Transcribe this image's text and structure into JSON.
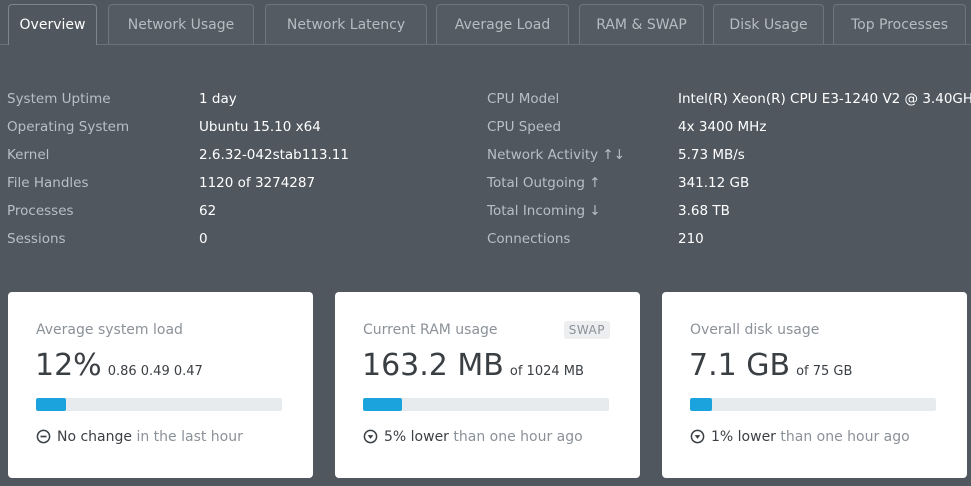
{
  "tabs": [
    {
      "label": "Overview"
    },
    {
      "label": "Network Usage"
    },
    {
      "label": "Network Latency"
    },
    {
      "label": "Average Load"
    },
    {
      "label": "RAM & SWAP"
    },
    {
      "label": "Disk Usage"
    },
    {
      "label": "Top Processes"
    }
  ],
  "info_left": [
    {
      "label": "System Uptime",
      "value": "1 day"
    },
    {
      "label": "Operating System",
      "value": "Ubuntu 15.10 x64"
    },
    {
      "label": "Kernel",
      "value": "2.6.32-042stab113.11"
    },
    {
      "label": "File Handles",
      "value": "1120 of 3274287"
    },
    {
      "label": "Processes",
      "value": "62"
    },
    {
      "label": "Sessions",
      "value": "0"
    }
  ],
  "info_right": [
    {
      "label": "CPU Model",
      "value": "Intel(R) Xeon(R) CPU E3-1240 V2 @ 3.40GH..."
    },
    {
      "label": "CPU Speed",
      "value": "4x 3400 MHz"
    },
    {
      "label": "Network Activity ↑↓",
      "value": "5.73 MB/s"
    },
    {
      "label": "Total Outgoing ↑",
      "value": "341.12 GB"
    },
    {
      "label": "Total Incoming ↓",
      "value": "3.68 TB"
    },
    {
      "label": "Connections",
      "value": "210"
    }
  ],
  "cards": {
    "load": {
      "title": "Average system load",
      "big": "12%",
      "sub": "0.86 0.49 0.47",
      "progress_fraction": 0.12,
      "trend_main": "No change",
      "trend_muted": " in the last hour",
      "trend_icon": "minus-circle-icon"
    },
    "ram": {
      "title": "Current RAM usage",
      "badge": "SWAP",
      "big": "163.2 MB",
      "sub": "of 1024 MB",
      "progress_fraction": 0.16,
      "trend_main": "5% lower",
      "trend_muted": " than one hour ago",
      "trend_icon": "arrow-down-circle-icon"
    },
    "disk": {
      "title": "Overall disk usage",
      "big": "7.1 GB",
      "sub": "of 75 GB",
      "progress_fraction": 0.09,
      "trend_main": "1% lower",
      "trend_muted": " than one hour ago",
      "trend_icon": "arrow-down-circle-icon"
    }
  },
  "colors": {
    "background": "#50575f",
    "accent": "#1aa3dc",
    "card": "#ffffff"
  }
}
